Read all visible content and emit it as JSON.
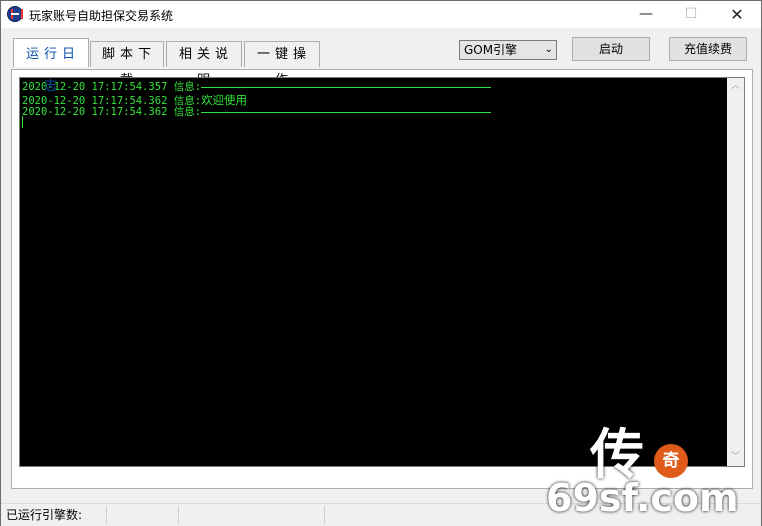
{
  "window": {
    "title": "玩家账号自助担保交易系统",
    "min_glyph": "—",
    "max_glyph": "☐",
    "close_glyph": "✕"
  },
  "tabs": [
    {
      "label": "运行日志",
      "active": true
    },
    {
      "label": "脚本下载",
      "active": false
    },
    {
      "label": "相关说明",
      "active": false
    },
    {
      "label": "一键操作",
      "active": false
    }
  ],
  "toolbar": {
    "engine_select": {
      "selected": "GOM引擎"
    },
    "start_label": "启动",
    "recharge_label": "充值续费"
  },
  "log": {
    "lines": [
      {
        "time": "2020-12-20 17:17:54.357",
        "prefix": "信息:",
        "text": "",
        "separator": true
      },
      {
        "time": "2020-12-20 17:17:54.362",
        "prefix": "信息:",
        "text": "欢迎使用",
        "separator": false
      },
      {
        "time": "2020-12-20 17:17:54.362",
        "prefix": "信息:",
        "text": "",
        "separator": true
      }
    ]
  },
  "status": {
    "engine_count_label": "已运行引擎数:"
  },
  "watermark": {
    "chars": "传",
    "seal": "奇",
    "domain": "69sf.com"
  },
  "icons": [
    "app-icon",
    "minimize-icon",
    "maximize-icon",
    "close-icon",
    "chevron-down-icon",
    "scroll-up-icon",
    "scroll-down-icon"
  ],
  "colors": {
    "log_text": "#33e33a",
    "log_bg": "#000000",
    "active_tab_text": "#0b4fa8",
    "seal": "#e05a1a"
  }
}
